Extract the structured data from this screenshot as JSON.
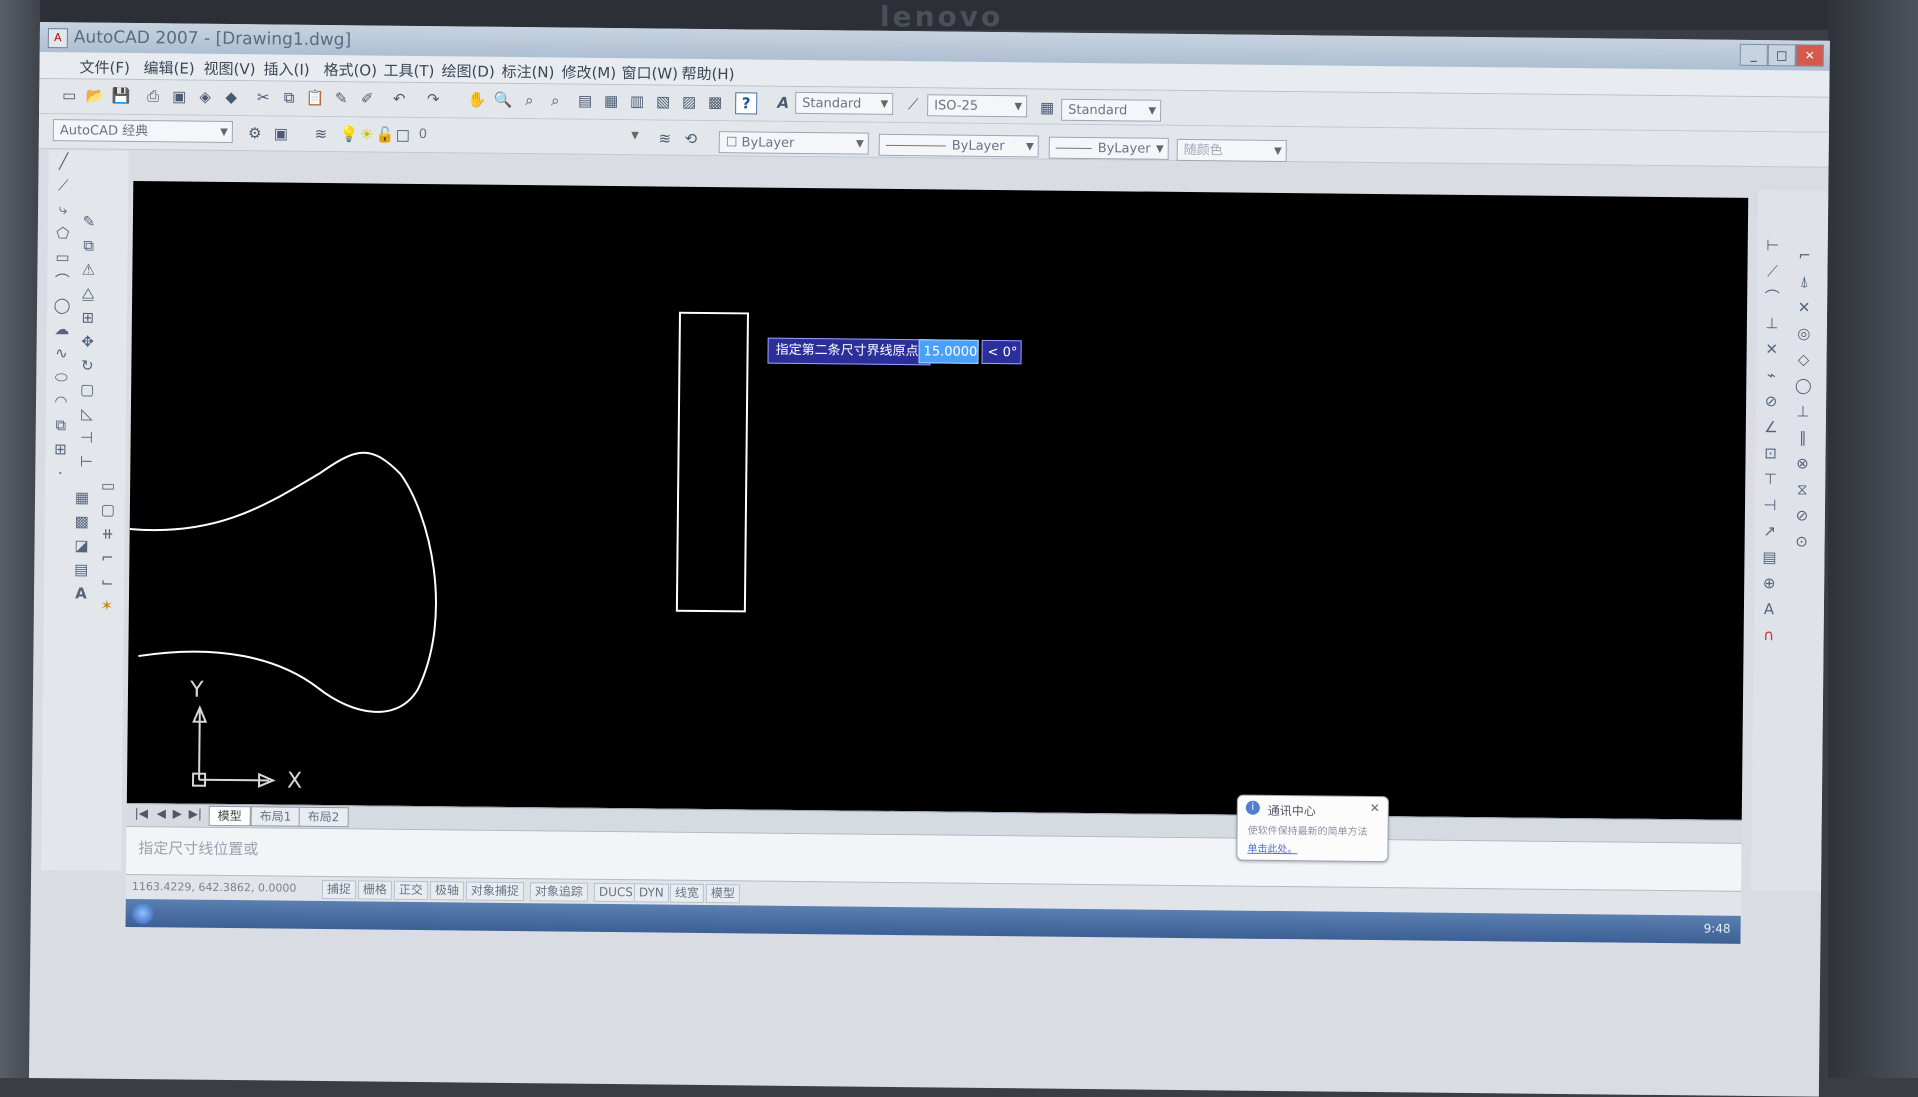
{
  "window": {
    "title": "AutoCAD 2007 - [Drawing1.dwg]"
  },
  "brand": "lenovo",
  "menu": [
    "文件(F)",
    "编辑(E)",
    "视图(V)",
    "插入(I)",
    "格式(O)",
    "工具(T)",
    "绘图(D)",
    "标注(N)",
    "修改(M)",
    "窗口(W)",
    "帮助(H)"
  ],
  "toolbars": {
    "text_style": "Standard",
    "dim_style": "ISO-25",
    "table_style": "Standard",
    "workspace": "AutoCAD 经典",
    "layer_value": "0",
    "color": "ByLayer",
    "linetype": "ByLayer",
    "lineweight": "ByLayer",
    "plot_style": "随颜色"
  },
  "dynamic_input": {
    "prompt": "指定第二条尺寸界线原点:",
    "value": "15.0000",
    "angle": "< 0°"
  },
  "ucs": {
    "x": "X",
    "y": "Y"
  },
  "layout_tabs": [
    "模型",
    "布局1",
    "布局2"
  ],
  "command_line": {
    "text": "指定尺寸线位置或"
  },
  "statusbar": {
    "coords": "1163.4229, 642.3862, 0.0000",
    "buttons": [
      "捕捉",
      "栅格",
      "正交",
      "极轴",
      "对象捕捉",
      "对象追踪",
      "DUCS",
      "DYN",
      "线宽",
      "模型"
    ]
  },
  "balloon": {
    "title": "通讯中心",
    "text": "使软件保持最新的简单方法",
    "link": "单击此处。"
  },
  "taskbar": {
    "clock": "9:48"
  },
  "colors": {
    "canvas": "#000000",
    "geometry": "#ffffff",
    "dyn_prompt_bg": "#2a2f9a",
    "dyn_value_bg": "#4aa0ff"
  }
}
